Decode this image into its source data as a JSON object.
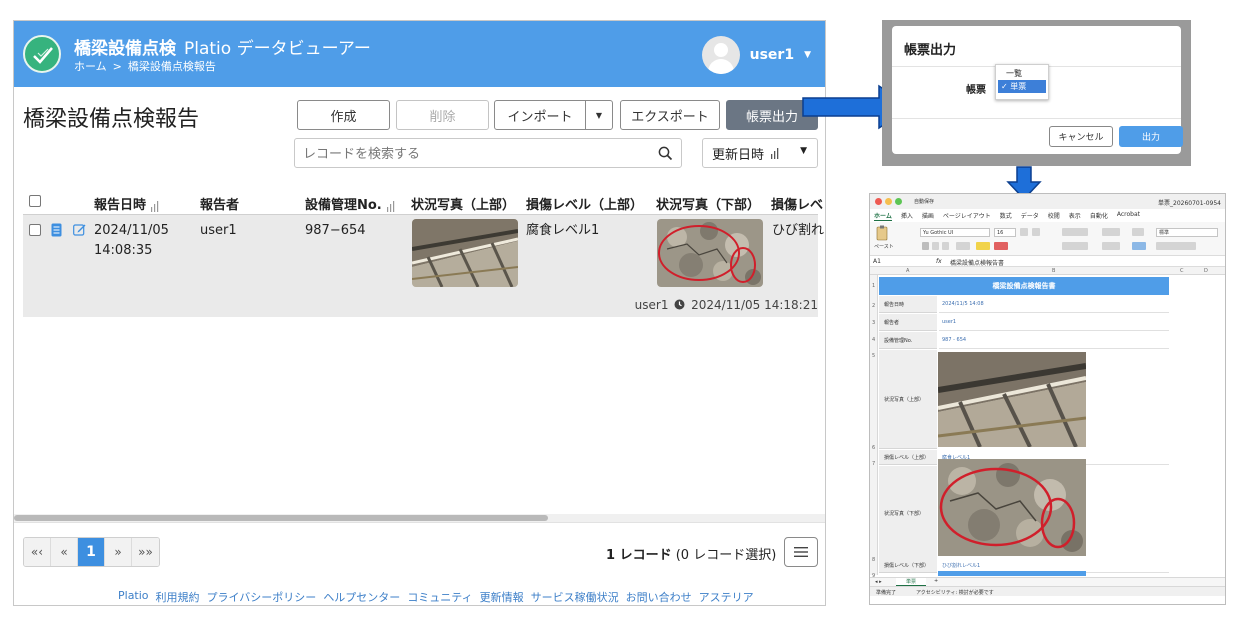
{
  "app": {
    "title": "橋梁設備点検",
    "subtitle": "Platio データビューアー",
    "breadcrumb": [
      "ホーム",
      ">",
      "橋梁設備点検報告"
    ],
    "user": "user1",
    "page_title": "橋梁設備点検報告",
    "colors": {
      "header": "#4f9de8",
      "logo": "#36b37e",
      "pager_active": "#3d8fe0",
      "footer_link": "#3d7fc8"
    }
  },
  "toolbar": {
    "create": "作成",
    "delete": "削除",
    "import": "インポート",
    "export": "エクスポート",
    "report_output": "帳票出力"
  },
  "search": {
    "placeholder": "レコードを検索する"
  },
  "sort": {
    "label": "更新日時"
  },
  "table": {
    "headers": [
      "報告日時",
      "報告者",
      "設備管理No.",
      "状況写真（上部）",
      "損傷レベル（上部）",
      "状況写真（下部）",
      "損傷レベ"
    ],
    "rows": [
      {
        "date": "2024/11/05",
        "time": "14:08:35",
        "reporter": "user1",
        "equipment_no": "987−654",
        "damage_upper": "腐食レベル1",
        "damage_lower": "ひび割れ",
        "meta_user": "user1",
        "meta_time": "2024/11/05 14:18:21"
      }
    ]
  },
  "pager": {
    "first": "«‹",
    "prev": "«",
    "current": "1",
    "next": "»",
    "last": "»»"
  },
  "record_count": {
    "count": "1 レコード",
    "selected": "(0 レコード選択)"
  },
  "footer_links": [
    "Platio",
    "利用規約",
    "プライバシーポリシー",
    "ヘルプセンター",
    "コミュニティ",
    "更新情報",
    "サービス稼働状況",
    "お問い合わせ",
    "アステリア"
  ],
  "dialog": {
    "title": "帳票出力",
    "field_label": "帳票",
    "options": [
      "一覧",
      "✓ 単票"
    ],
    "cancel": "キャンセル",
    "ok": "出力"
  },
  "excel": {
    "file_name": "単票_20260701-0954",
    "autosave": "自動保存",
    "menu": [
      "ホーム",
      "挿入",
      "描画",
      "ページレイアウト",
      "数式",
      "データ",
      "校閲",
      "表示",
      "自動化",
      "Acrobat"
    ],
    "font_name": "Yu Gothic UI",
    "font_size": "16",
    "number_format": "標準",
    "paste": "ペースト",
    "cell_ref": "A1",
    "fx": "fx",
    "formula": "橋梁設備点検報告書",
    "col_a": "A",
    "col_b": "B",
    "col_c": "C",
    "col_d": "D",
    "banner": "橋梁設備点検報告書",
    "labels": {
      "date": "報告日時",
      "reporter": "報告者",
      "equipment": "設備管理No.",
      "photo_upper": "状況写真（上部）",
      "damage_upper": "損傷レベル（上部）",
      "photo_lower": "状況写真（下部）",
      "damage_lower": "損傷レベル（下部）"
    },
    "values": {
      "date": "2024/11/5 14:08",
      "reporter": "user1",
      "equipment": "987 - 654",
      "damage_upper": "腐食レベル1",
      "damage_lower": "ひび割れレベル1"
    },
    "sheet_tab": "単票",
    "status_ready": "準備完了",
    "status_access": "アクセシビリティ: 検討が必要です"
  }
}
